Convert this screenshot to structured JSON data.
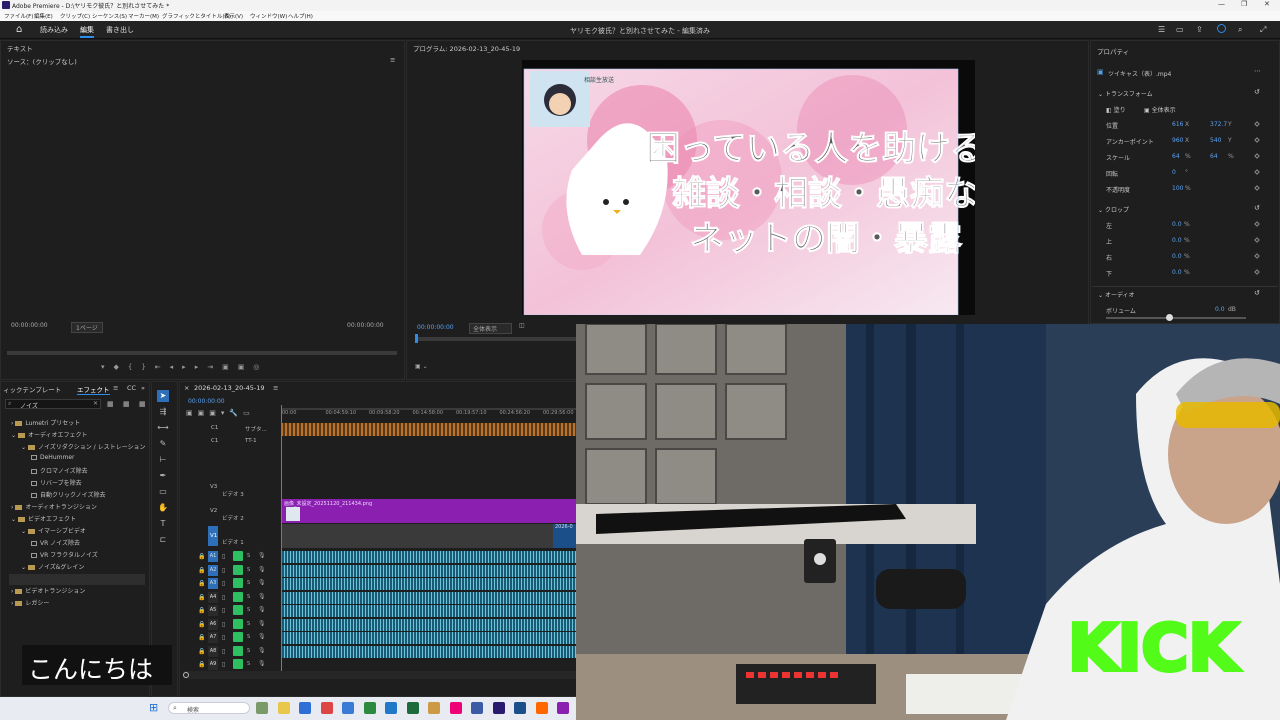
{
  "window": {
    "title": "Adobe Premiere - D:\\ヤリモク彼氏？と別れさせてみた *"
  },
  "menu": [
    "ファイル(F)",
    "編集(E)",
    "クリップ(C)",
    "シーケンス(S)",
    "マーカー(M)",
    "グラフィックとタイトル(G)",
    "表示(V)",
    "ウィンドウ(W)",
    "ヘルプ(H)"
  ],
  "header": {
    "tabs": [
      "読み込み",
      "編集",
      "書き出し"
    ],
    "project_title": "ヤリモク彼氏？と別れさせてみた - 編集済み"
  },
  "source_panel": {
    "tab": "テキスト",
    "source_label": "ソース：(クリップなし)",
    "timecode_left": "00:00:00:00",
    "timecode_right": "00:00:00:00",
    "zoom": "1ページ"
  },
  "program_panel": {
    "title": "プログラム: 2026-02-13_20-45-19",
    "timecode": "00:00:00:00",
    "fit": "全体表示",
    "thumbnail": {
      "badge": "相談生放送",
      "line1": "困っている人を助ける",
      "line2": "雑談・相談・愚痴など",
      "line3": "ネットの闇・暴露"
    }
  },
  "properties": {
    "title": "プロパティ",
    "clip": "ツイキャス（表）.mp4",
    "transform": "トランスフォーム",
    "flip": "塗り",
    "show_all": "全体表示",
    "rows": [
      {
        "label": "位置",
        "v1": "616",
        "u1": "X",
        "v2": "372.7",
        "u2": "Y"
      },
      {
        "label": "アンカーポイント",
        "v1": "960",
        "u1": "X",
        "v2": "540",
        "u2": "Y"
      },
      {
        "label": "スケール",
        "v1": "64",
        "u1": "%",
        "v2": "64",
        "u2": "%"
      },
      {
        "label": "回転",
        "v1": "0",
        "u1": "°",
        "v2": "",
        "u2": ""
      },
      {
        "label": "不透明度",
        "v1": "100",
        "u1": "%",
        "v2": "",
        "u2": ""
      }
    ],
    "crop": "クロップ",
    "crop_rows": [
      {
        "label": "左",
        "v": "0.0",
        "u": "%"
      },
      {
        "label": "上",
        "v": "0.0",
        "u": "%"
      },
      {
        "label": "右",
        "v": "0.0",
        "u": "%"
      },
      {
        "label": "下",
        "v": "0.0",
        "u": "%"
      }
    ],
    "audio": "オーディオ",
    "volume_label": "ボリューム",
    "volume_value": "0.0",
    "volume_unit": "dB",
    "volume_level": 0.45
  },
  "effects_panel": {
    "tabs": [
      "ィックテンプレート",
      "エフェクト",
      "CC"
    ],
    "search": "ノイズ",
    "tree": [
      {
        "label": "Lumetri プリセット",
        "depth": 0,
        "kind": "folder"
      },
      {
        "label": "オーディオエフェクト",
        "depth": 0,
        "kind": "folder"
      },
      {
        "label": "ノイズリダクション / レストレーション",
        "depth": 1,
        "kind": "folder"
      },
      {
        "label": "DeHummer",
        "depth": 2,
        "kind": "fx"
      },
      {
        "label": "クロマノイズ除去",
        "depth": 2,
        "kind": "fx"
      },
      {
        "label": "リバーブを除去",
        "depth": 2,
        "kind": "fx"
      },
      {
        "label": "自動クリックノイズ除去",
        "depth": 2,
        "kind": "fx"
      },
      {
        "label": "オーディオトランジション",
        "depth": 0,
        "kind": "folder"
      },
      {
        "label": "ビデオエフェクト",
        "depth": 0,
        "kind": "folder"
      },
      {
        "label": "イマーシブビデオ",
        "depth": 1,
        "kind": "folder"
      },
      {
        "label": "VR ノイズ除去",
        "depth": 2,
        "kind": "fx"
      },
      {
        "label": "VR フラクタルノイズ",
        "depth": 2,
        "kind": "fx"
      },
      {
        "label": "ノイズ&グレイン",
        "depth": 1,
        "kind": "folder"
      },
      {
        "label": "ノイズ",
        "depth": 2,
        "kind": "fx"
      },
      {
        "label": "ビデオトランジション",
        "depth": 0,
        "kind": "folder"
      },
      {
        "label": "レガシー",
        "depth": 0,
        "kind": "folder"
      }
    ]
  },
  "timeline": {
    "sequence": "2026-02-13_20-45-19",
    "timecode": "00:00:00:00",
    "ruler": [
      "00:00",
      "00:04:59:10",
      "00:09:58:20",
      "00:14:58:00",
      "00:19:57:10",
      "00:24:56:20",
      "00:29:56:00"
    ],
    "tracks_top": [
      {
        "id": "C1",
        "name": "サブタ..."
      },
      {
        "id": "C1",
        "name": "TT-1"
      }
    ],
    "video_tracks": [
      {
        "id": "V3",
        "name": "ビデオ 3"
      },
      {
        "id": "V2",
        "name": "ビデオ 2"
      },
      {
        "id": "V1",
        "name": "ビデオ 1"
      }
    ],
    "clip_v2": "画像_未設定_20251120_211434.png",
    "clip_v1": "2026-0",
    "audio_tracks": [
      "A1",
      "A2",
      "A3",
      "A4",
      "A5",
      "A6",
      "A7",
      "A8",
      "A9"
    ]
  },
  "overlay": {
    "subtitle": "こんにちは",
    "kick": "KICK"
  },
  "taskbar": {
    "search": "検索"
  },
  "colors": {
    "accent": "#2d8ceb",
    "kick": "#53fc18",
    "clip_purple": "#8a1fb0",
    "audio": "#1b5a73"
  }
}
